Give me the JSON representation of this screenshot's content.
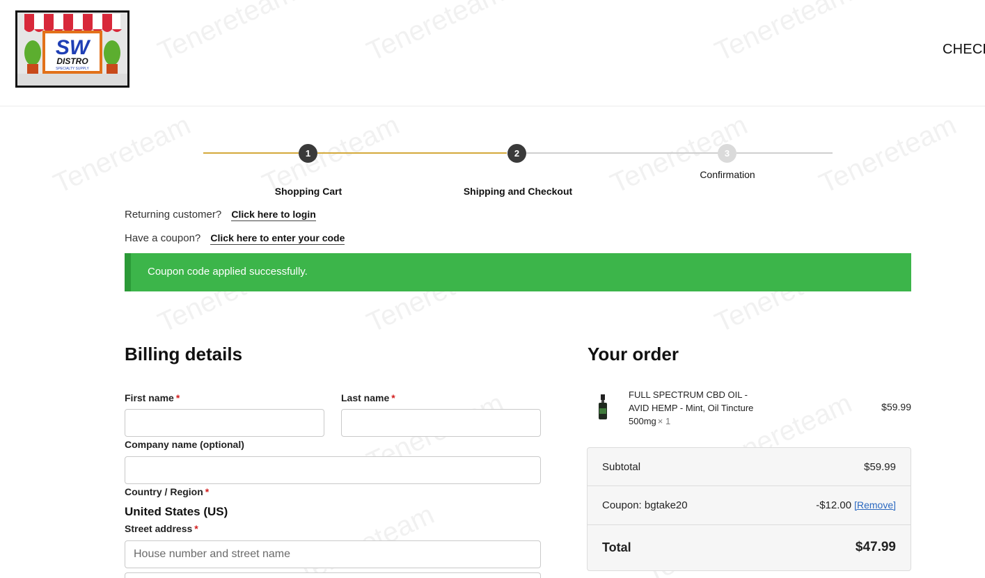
{
  "header": {
    "logo": {
      "text_main": "SW",
      "text_sub": "DISTRO",
      "text_tag": "SPECIALTY SUPPLY"
    },
    "nav_checkout_label": "CHECK"
  },
  "stepper": {
    "steps": [
      {
        "number": "1",
        "label": "Shopping Cart",
        "state": "completed"
      },
      {
        "number": "2",
        "label": "Shipping and Checkout",
        "state": "current"
      },
      {
        "number": "3",
        "label": "Confirmation",
        "state": "upcoming"
      }
    ],
    "colors": {
      "progress": "#d4a93a",
      "pending": "#cfcfcf",
      "active_circle": "#3a3a3a",
      "inactive_circle": "#dadada"
    }
  },
  "notices": {
    "returning_prompt": "Returning customer?",
    "login_link": "Click here to login",
    "coupon_prompt": "Have a coupon?",
    "coupon_link": "Click here to enter your code",
    "success_message": "Coupon code applied successfully.",
    "success_color": "#3cb54a"
  },
  "billing": {
    "title": "Billing details",
    "first_name_label": "First name",
    "last_name_label": "Last name",
    "company_label": "Company name (optional)",
    "country_label": "Country / Region",
    "country_value": "United States (US)",
    "street_label": "Street address",
    "street_placeholder": "House number and street name",
    "required_marker": "*"
  },
  "order": {
    "title": "Your order",
    "item": {
      "name": "FULL SPECTRUM CBD OIL - AVID HEMP - Mint, Oil Tincture 500mg",
      "quantity": "× 1",
      "price": "$59.99"
    },
    "subtotal_label": "Subtotal",
    "subtotal_value": "$59.99",
    "coupon_label": "Coupon: bgtake20",
    "coupon_value": "-$12.00",
    "coupon_remove": "[Remove]",
    "total_label": "Total",
    "total_value": "$47.99"
  },
  "watermark_text": "Tenereteam"
}
